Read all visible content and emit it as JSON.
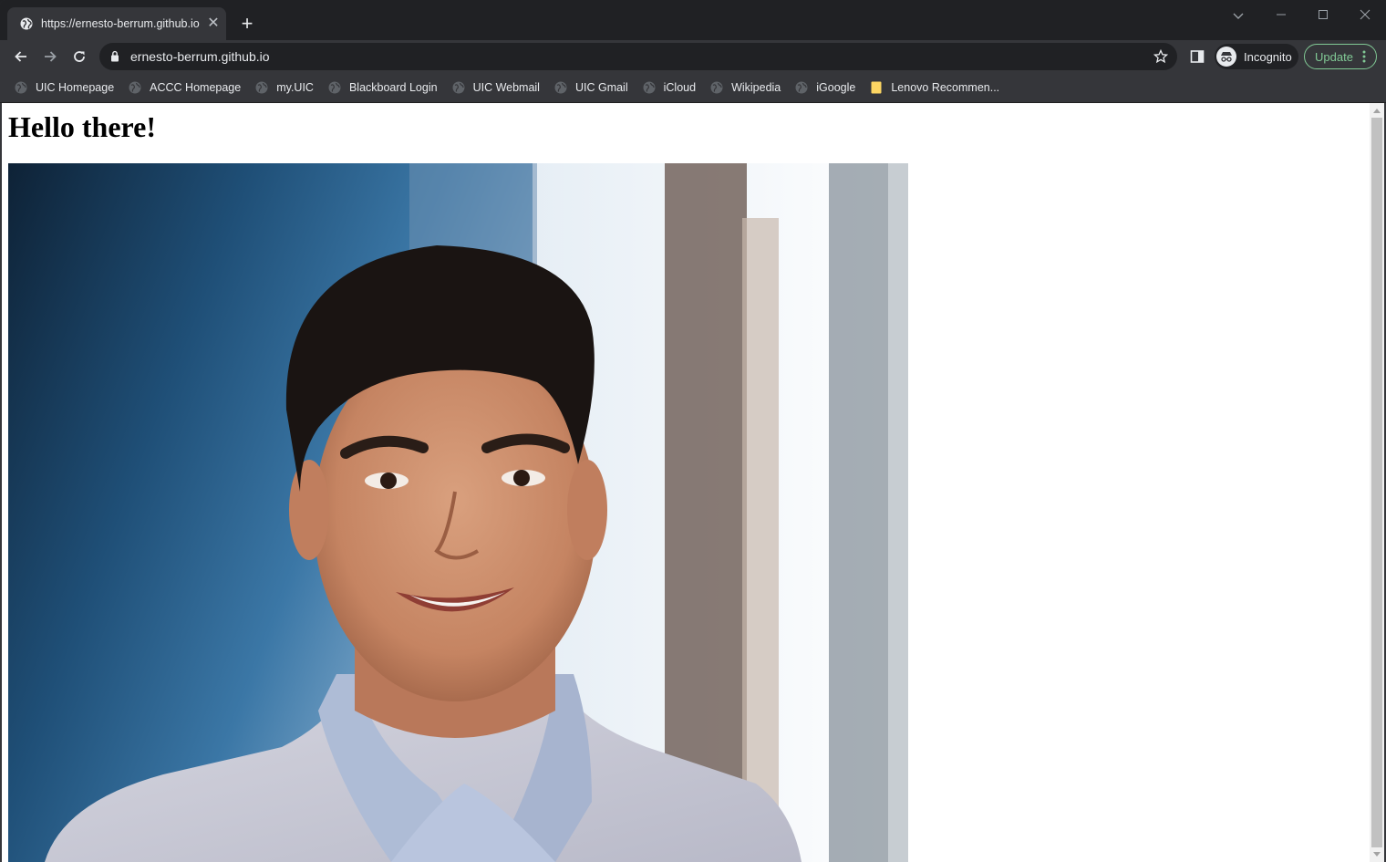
{
  "tab": {
    "title": "https://ernesto-berrum.github.io",
    "favicon": "globe-icon"
  },
  "omnibox": {
    "url": "ernesto-berrum.github.io"
  },
  "profile": {
    "label": "Incognito"
  },
  "update": {
    "label": "Update"
  },
  "bookmarks": [
    {
      "label": "UIC Homepage",
      "icon": "globe-icon"
    },
    {
      "label": "ACCC Homepage",
      "icon": "globe-icon"
    },
    {
      "label": "my.UIC",
      "icon": "globe-icon"
    },
    {
      "label": "Blackboard Login",
      "icon": "globe-icon"
    },
    {
      "label": "UIC Webmail",
      "icon": "globe-icon"
    },
    {
      "label": "UIC Gmail",
      "icon": "globe-icon"
    },
    {
      "label": "iCloud",
      "icon": "globe-icon"
    },
    {
      "label": "Wikipedia",
      "icon": "globe-icon"
    },
    {
      "label": "iGoogle",
      "icon": "globe-icon"
    },
    {
      "label": "Lenovo Recommen...",
      "icon": "folder-icon"
    }
  ],
  "page": {
    "heading": "Hello there!"
  },
  "colors": {
    "chrome_dark": "#202124",
    "toolbar": "#35363a",
    "update_green": "#81c995"
  }
}
